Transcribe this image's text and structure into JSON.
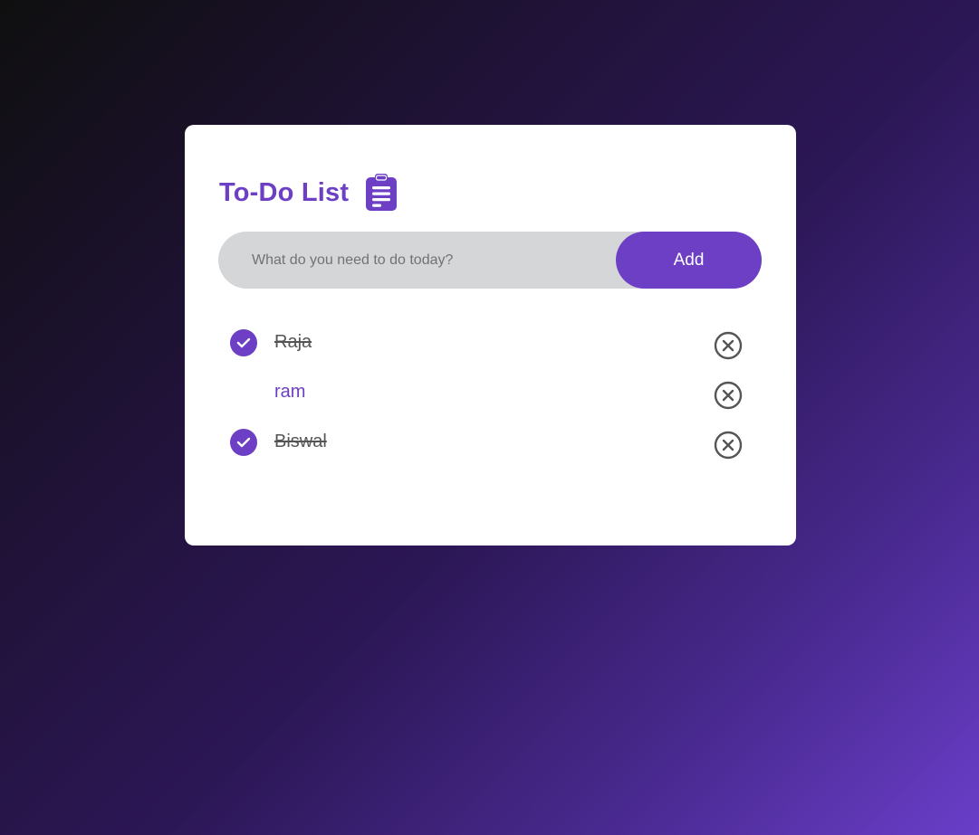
{
  "app": {
    "title": "To-Do List",
    "icon": "clipboard-icon"
  },
  "input": {
    "placeholder": "What do you need to do today?",
    "value": ""
  },
  "add_button": {
    "label": "Add"
  },
  "tasks": [
    {
      "text": "Raja",
      "completed": true
    },
    {
      "text": "ram",
      "completed": false
    },
    {
      "text": "Biswal",
      "completed": true
    }
  ],
  "colors": {
    "accent": "#6c3fc4",
    "done_text": "#555555",
    "input_bg": "#d5d6d8"
  }
}
